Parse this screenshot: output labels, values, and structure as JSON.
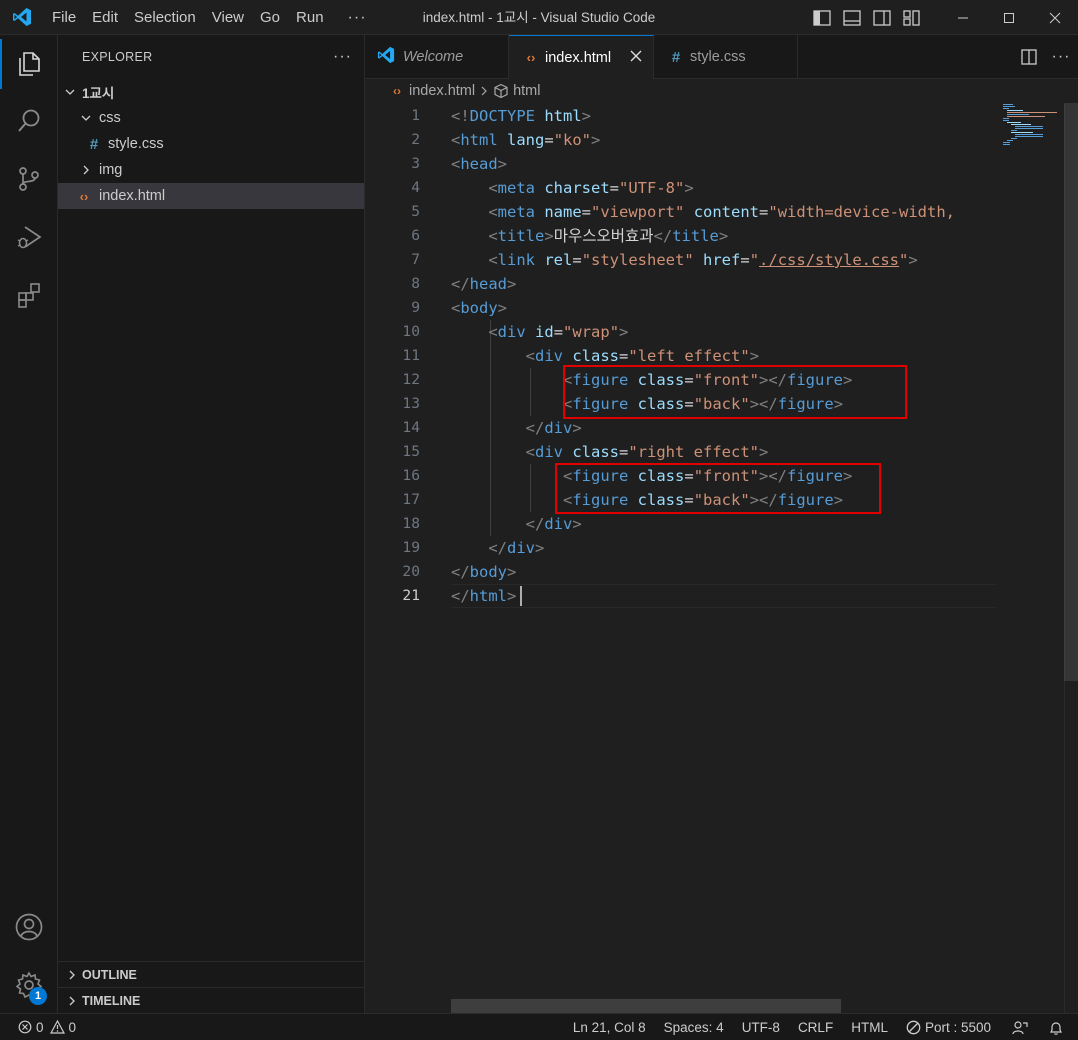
{
  "titlebar": {
    "menu": [
      "File",
      "Edit",
      "Selection",
      "View",
      "Go",
      "Run"
    ],
    "more": "···",
    "title": "index.html - 1교시 - Visual Studio Code"
  },
  "activity": {
    "icons": [
      "explorer-icon",
      "search-icon",
      "source-control-icon",
      "run-debug-icon",
      "extensions-icon",
      "account-icon",
      "gear-icon"
    ],
    "settings_badge": "1"
  },
  "sidebar": {
    "title": "EXPLORER",
    "more": "···",
    "root": "1교시",
    "items": [
      {
        "label": "css",
        "type": "folder-open"
      },
      {
        "label": "style.css",
        "type": "css-file"
      },
      {
        "label": "img",
        "type": "folder-closed"
      },
      {
        "label": "index.html",
        "type": "html-file"
      }
    ],
    "outline": "OUTLINE",
    "timeline": "TIMELINE"
  },
  "tabs": [
    {
      "label": "Welcome",
      "icon": "vscode-icon"
    },
    {
      "label": "index.html",
      "icon": "html-icon"
    },
    {
      "label": "style.css",
      "icon": "css-icon"
    }
  ],
  "breadcrumb": {
    "file": "index.html",
    "symbol": "html"
  },
  "editor": {
    "current_line": 21,
    "line_numbers": [
      "1",
      "2",
      "3",
      "4",
      "5",
      "6",
      "7",
      "8",
      "9",
      "10",
      "11",
      "12",
      "13",
      "14",
      "15",
      "16",
      "17",
      "18",
      "19",
      "20",
      "21"
    ],
    "lines": [
      "<!DOCTYPE html>",
      "<html lang=\"ko\">",
      "<head>",
      "    <meta charset=\"UTF-8\">",
      "    <meta name=\"viewport\" content=\"width=device-width,",
      "    <title>마우스오버효과</title>",
      "    <link rel=\"stylesheet\" href=\"./css/style.css\">",
      "</head>",
      "<body>",
      "    <div id=\"wrap\">",
      "        <div class=\"left effect\">",
      "            <figure class=\"front\"></figure>",
      "            <figure class=\"back\"></figure>",
      "        </div>",
      "        <div class=\"right effect\">",
      "            <figure class=\"front\"></figure>",
      "            <figure class=\"back\"></figure>",
      "        </div>",
      "    </div>",
      "</body>",
      "</html>"
    ]
  },
  "status": {
    "errors": "0",
    "warnings": "0",
    "position": "Ln 21, Col 8",
    "spaces": "Spaces: 4",
    "encoding": "UTF-8",
    "eol": "CRLF",
    "language": "HTML",
    "port": "Port : 5500"
  },
  "colors": {
    "accent": "#0078d4",
    "tag": "#569cd6",
    "attribute": "#9cdcfe",
    "string": "#ce9178",
    "highlight_box": "#e00000"
  }
}
